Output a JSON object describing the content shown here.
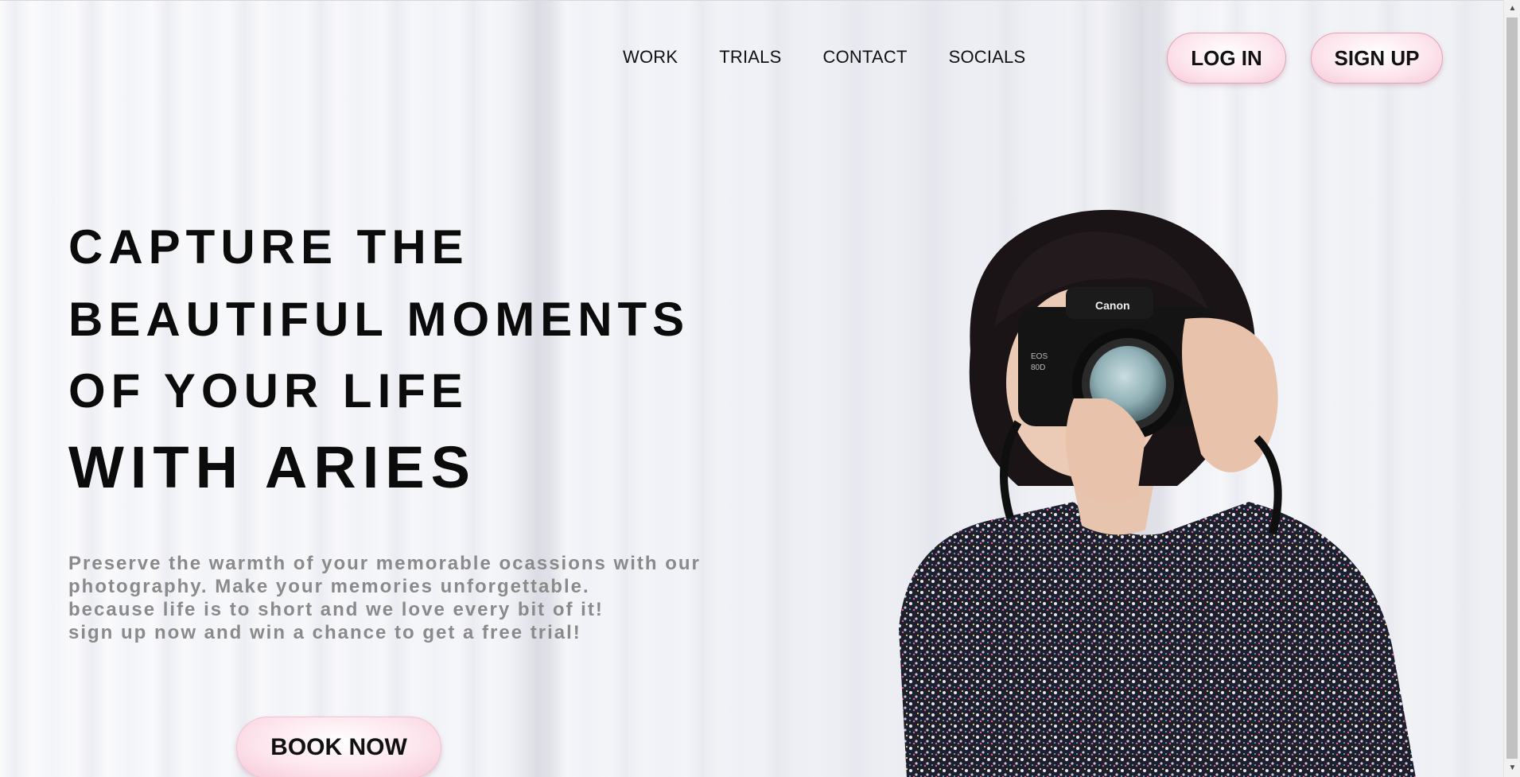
{
  "nav": {
    "links": [
      "WORK",
      "TRIALS",
      "CONTACT",
      "SOCIALS"
    ],
    "login_label": "LOG IN",
    "signup_label": "SIGN UP"
  },
  "hero": {
    "line1": "CAPTURE THE",
    "line2": "BEAUTIFUL MOMENTS",
    "line3": "OF YOUR LIFE",
    "line4": "WITH ARIES",
    "description": [
      "Preserve the warmth of your memorable ocassions with our",
      "photography. Make your memories unforgettable.",
      "because life is to short and we love every bit of it!",
      "sign up now and win a chance to get a free trial!"
    ],
    "cta_label": "BOOK NOW"
  },
  "camera": {
    "brand": "Canon",
    "model_top": "EOS",
    "model_bottom": "80D"
  },
  "colors": {
    "button_pink": "#fde6ee",
    "button_border": "#e3a4b7",
    "heading": "#0b0b0b",
    "description": "#8a8a8a"
  },
  "icons": {
    "scroll_up": "scroll-up-arrow-icon",
    "scroll_down": "scroll-down-arrow-icon"
  }
}
